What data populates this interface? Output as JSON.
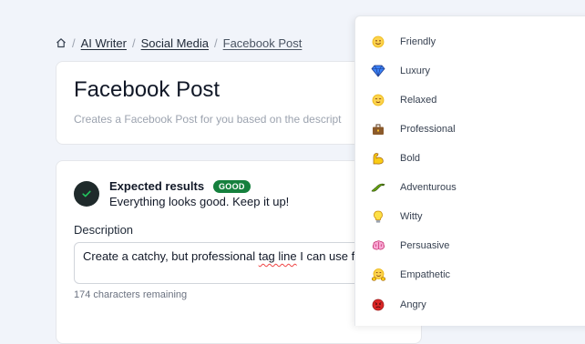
{
  "breadcrumb": {
    "items": [
      "AI Writer",
      "Social Media",
      "Facebook Post"
    ],
    "separator": "/"
  },
  "title_card": {
    "title": "Facebook Post",
    "description": "Creates a Facebook Post for you based on the descript"
  },
  "result": {
    "title": "Expected results",
    "badge": "GOOD",
    "message": "Everything looks good. Keep it up!"
  },
  "description": {
    "label": "Description",
    "value_before": "Create a catchy, but professional ",
    "value_misspelled": "tag line",
    "value_after": " I can use for",
    "remaining": "174 characters remaining"
  },
  "tone_menu": {
    "options": [
      {
        "label": "Friendly",
        "icon": "smile-emoji-icon"
      },
      {
        "label": "Luxury",
        "icon": "diamond-emoji-icon"
      },
      {
        "label": "Relaxed",
        "icon": "relieved-emoji-icon"
      },
      {
        "label": "Professional",
        "icon": "briefcase-emoji-icon"
      },
      {
        "label": "Bold",
        "icon": "flexed-biceps-emoji-icon"
      },
      {
        "label": "Adventurous",
        "icon": "lizard-emoji-icon"
      },
      {
        "label": "Witty",
        "icon": "lightbulb-emoji-icon"
      },
      {
        "label": "Persuasive",
        "icon": "brain-emoji-icon"
      },
      {
        "label": "Empathetic",
        "icon": "hugging-emoji-icon"
      },
      {
        "label": "Angry",
        "icon": "angry-emoji-icon"
      }
    ]
  },
  "colors": {
    "badge_good": "#15803d",
    "check_circle": "#1f2a2b",
    "page_bg": "#f1f4fa"
  }
}
